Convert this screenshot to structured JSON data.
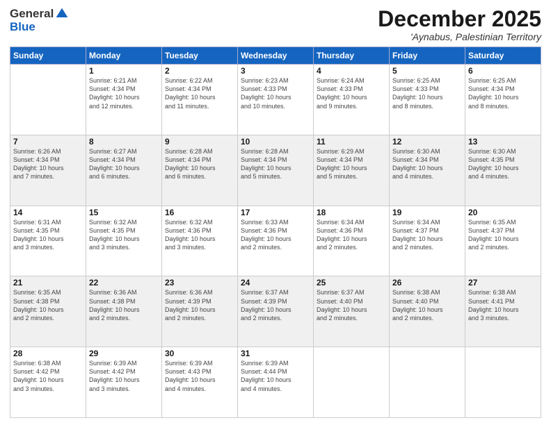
{
  "logo": {
    "general": "General",
    "blue": "Blue"
  },
  "title": "December 2025",
  "location": "'Aynabus, Palestinian Territory",
  "days_of_week": [
    "Sunday",
    "Monday",
    "Tuesday",
    "Wednesday",
    "Thursday",
    "Friday",
    "Saturday"
  ],
  "weeks": [
    [
      {
        "day": "",
        "info": ""
      },
      {
        "day": "1",
        "info": "Sunrise: 6:21 AM\nSunset: 4:34 PM\nDaylight: 10 hours\nand 12 minutes."
      },
      {
        "day": "2",
        "info": "Sunrise: 6:22 AM\nSunset: 4:34 PM\nDaylight: 10 hours\nand 11 minutes."
      },
      {
        "day": "3",
        "info": "Sunrise: 6:23 AM\nSunset: 4:33 PM\nDaylight: 10 hours\nand 10 minutes."
      },
      {
        "day": "4",
        "info": "Sunrise: 6:24 AM\nSunset: 4:33 PM\nDaylight: 10 hours\nand 9 minutes."
      },
      {
        "day": "5",
        "info": "Sunrise: 6:25 AM\nSunset: 4:33 PM\nDaylight: 10 hours\nand 8 minutes."
      },
      {
        "day": "6",
        "info": "Sunrise: 6:25 AM\nSunset: 4:34 PM\nDaylight: 10 hours\nand 8 minutes."
      }
    ],
    [
      {
        "day": "7",
        "info": "Sunrise: 6:26 AM\nSunset: 4:34 PM\nDaylight: 10 hours\nand 7 minutes."
      },
      {
        "day": "8",
        "info": "Sunrise: 6:27 AM\nSunset: 4:34 PM\nDaylight: 10 hours\nand 6 minutes."
      },
      {
        "day": "9",
        "info": "Sunrise: 6:28 AM\nSunset: 4:34 PM\nDaylight: 10 hours\nand 6 minutes."
      },
      {
        "day": "10",
        "info": "Sunrise: 6:28 AM\nSunset: 4:34 PM\nDaylight: 10 hours\nand 5 minutes."
      },
      {
        "day": "11",
        "info": "Sunrise: 6:29 AM\nSunset: 4:34 PM\nDaylight: 10 hours\nand 5 minutes."
      },
      {
        "day": "12",
        "info": "Sunrise: 6:30 AM\nSunset: 4:34 PM\nDaylight: 10 hours\nand 4 minutes."
      },
      {
        "day": "13",
        "info": "Sunrise: 6:30 AM\nSunset: 4:35 PM\nDaylight: 10 hours\nand 4 minutes."
      }
    ],
    [
      {
        "day": "14",
        "info": "Sunrise: 6:31 AM\nSunset: 4:35 PM\nDaylight: 10 hours\nand 3 minutes."
      },
      {
        "day": "15",
        "info": "Sunrise: 6:32 AM\nSunset: 4:35 PM\nDaylight: 10 hours\nand 3 minutes."
      },
      {
        "day": "16",
        "info": "Sunrise: 6:32 AM\nSunset: 4:36 PM\nDaylight: 10 hours\nand 3 minutes."
      },
      {
        "day": "17",
        "info": "Sunrise: 6:33 AM\nSunset: 4:36 PM\nDaylight: 10 hours\nand 2 minutes."
      },
      {
        "day": "18",
        "info": "Sunrise: 6:34 AM\nSunset: 4:36 PM\nDaylight: 10 hours\nand 2 minutes."
      },
      {
        "day": "19",
        "info": "Sunrise: 6:34 AM\nSunset: 4:37 PM\nDaylight: 10 hours\nand 2 minutes."
      },
      {
        "day": "20",
        "info": "Sunrise: 6:35 AM\nSunset: 4:37 PM\nDaylight: 10 hours\nand 2 minutes."
      }
    ],
    [
      {
        "day": "21",
        "info": "Sunrise: 6:35 AM\nSunset: 4:38 PM\nDaylight: 10 hours\nand 2 minutes."
      },
      {
        "day": "22",
        "info": "Sunrise: 6:36 AM\nSunset: 4:38 PM\nDaylight: 10 hours\nand 2 minutes."
      },
      {
        "day": "23",
        "info": "Sunrise: 6:36 AM\nSunset: 4:39 PM\nDaylight: 10 hours\nand 2 minutes."
      },
      {
        "day": "24",
        "info": "Sunrise: 6:37 AM\nSunset: 4:39 PM\nDaylight: 10 hours\nand 2 minutes."
      },
      {
        "day": "25",
        "info": "Sunrise: 6:37 AM\nSunset: 4:40 PM\nDaylight: 10 hours\nand 2 minutes."
      },
      {
        "day": "26",
        "info": "Sunrise: 6:38 AM\nSunset: 4:40 PM\nDaylight: 10 hours\nand 2 minutes."
      },
      {
        "day": "27",
        "info": "Sunrise: 6:38 AM\nSunset: 4:41 PM\nDaylight: 10 hours\nand 3 minutes."
      }
    ],
    [
      {
        "day": "28",
        "info": "Sunrise: 6:38 AM\nSunset: 4:42 PM\nDaylight: 10 hours\nand 3 minutes."
      },
      {
        "day": "29",
        "info": "Sunrise: 6:39 AM\nSunset: 4:42 PM\nDaylight: 10 hours\nand 3 minutes."
      },
      {
        "day": "30",
        "info": "Sunrise: 6:39 AM\nSunset: 4:43 PM\nDaylight: 10 hours\nand 4 minutes."
      },
      {
        "day": "31",
        "info": "Sunrise: 6:39 AM\nSunset: 4:44 PM\nDaylight: 10 hours\nand 4 minutes."
      },
      {
        "day": "",
        "info": ""
      },
      {
        "day": "",
        "info": ""
      },
      {
        "day": "",
        "info": ""
      }
    ]
  ]
}
